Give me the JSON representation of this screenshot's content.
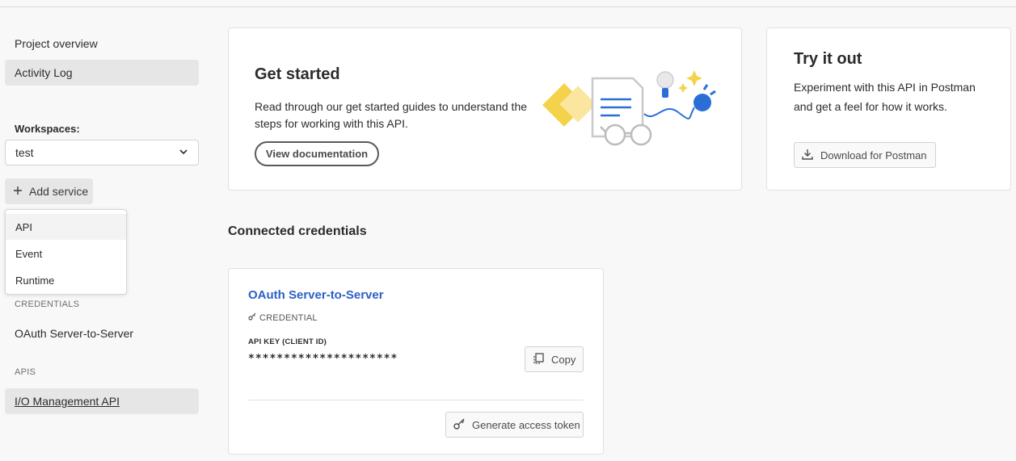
{
  "sidebar": {
    "items": [
      {
        "label": "Project overview"
      },
      {
        "label": "Activity Log"
      }
    ],
    "workspaces_label": "Workspaces:",
    "workspace_selected": "test",
    "add_service_label": "Add service",
    "add_service_menu": [
      "API",
      "Event",
      "Runtime"
    ],
    "credentials_heading": "CREDENTIALS",
    "credential_item": "OAuth Server-to-Server",
    "apis_heading": "APIS",
    "api_item": "I/O Management API"
  },
  "get_started": {
    "title": "Get started",
    "description": "Read through our get started guides to understand the steps for working with this API.",
    "button": "View documentation"
  },
  "try_it": {
    "title": "Try it out",
    "description": "Experiment with this API in Postman and get a feel for how it works.",
    "button": "Download for Postman"
  },
  "connected": {
    "title": "Connected credentials",
    "credential": {
      "name": "OAuth Server-to-Server",
      "type": "CREDENTIAL",
      "api_key_label": "API KEY (CLIENT ID)",
      "api_key_value": "*********************",
      "copy_label": "Copy",
      "generate_label": "Generate access token"
    }
  },
  "colors": {
    "link": "#2c5fc7",
    "illustration_yellow": "#f5d24b",
    "illustration_blue": "#2b6fd6"
  },
  "icons": [
    "chevron-down-icon",
    "plus-icon",
    "download-icon",
    "copy-icon",
    "key-icon"
  ]
}
